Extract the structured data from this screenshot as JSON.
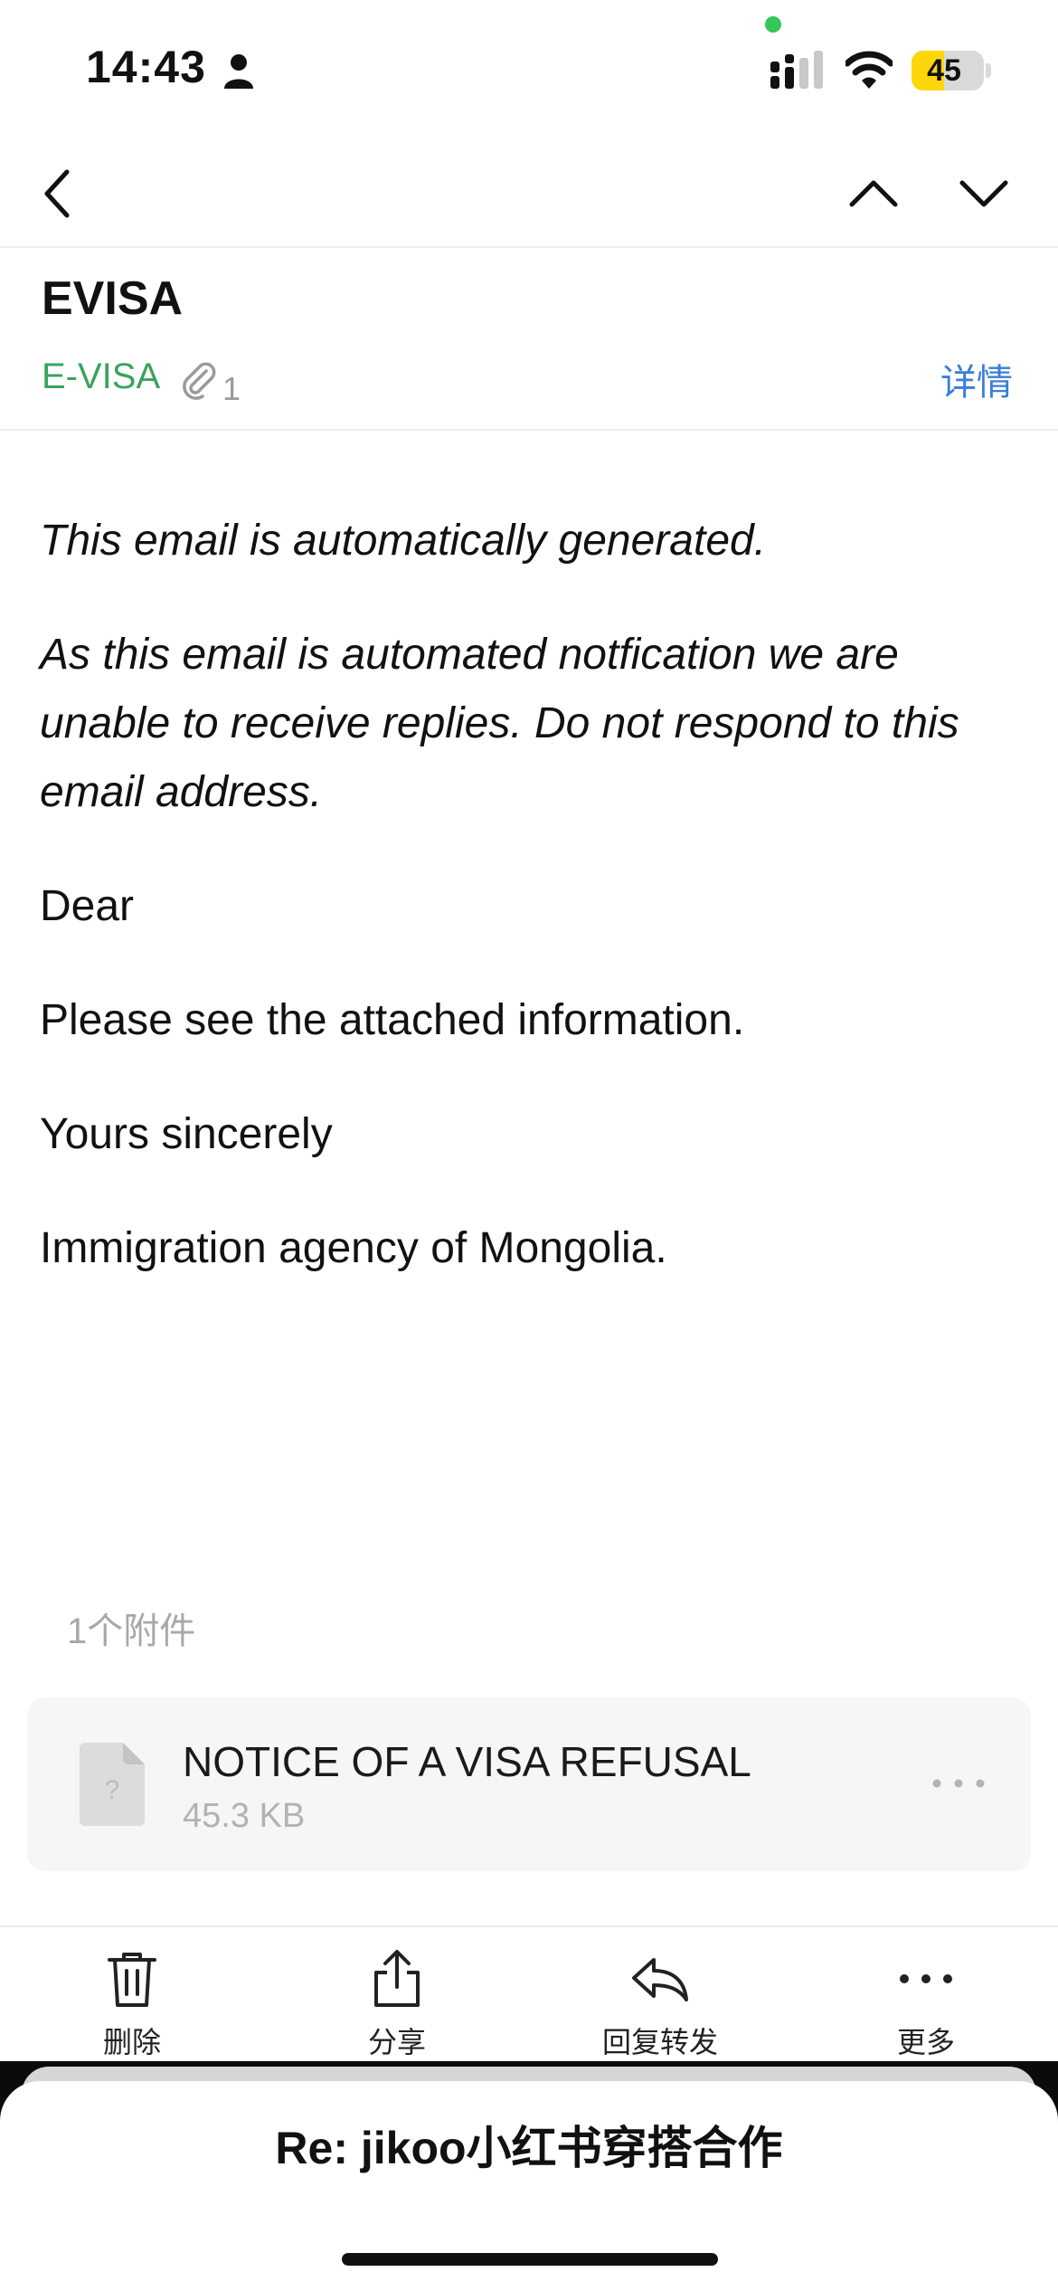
{
  "status_bar": {
    "time": "14:43",
    "battery_level": "45",
    "battery_fraction": 0.45,
    "icons": [
      "person-icon",
      "signal-icon",
      "wifi-icon",
      "battery-icon"
    ],
    "mic_indicator_color": "#34c759"
  },
  "nav": {
    "back_icon": "chevron-left-icon",
    "prev_icon": "chevron-up-icon",
    "next_icon": "chevron-down-icon"
  },
  "header": {
    "subject": "EVISA",
    "sender": "E-VISA",
    "attachment_count": "1",
    "details_label": "详情",
    "sender_color": "#3aa35c",
    "link_color": "#3a7ed6"
  },
  "body": {
    "paragraphs": [
      {
        "text": "This email is automatically generated.",
        "italic": true
      },
      {
        "text": "As this email is automated notfication we are unable to receive replies. Do not respond to this email address.",
        "italic": true
      },
      {
        "text": "Dear",
        "italic": false
      },
      {
        "text": "Please see the attached information.",
        "italic": false
      },
      {
        "text": "Yours sincerely",
        "italic": false
      },
      {
        "text": "Immigration agency of Mongolia.",
        "italic": false
      }
    ]
  },
  "attachments": {
    "heading": "1个附件",
    "items": [
      {
        "name": "NOTICE OF A VISA REFUSAL",
        "size": "45.3 KB",
        "icon": "unknown-file-icon"
      }
    ]
  },
  "toolbar": {
    "delete_label": "删除",
    "share_label": "分享",
    "reply_forward_label": "回复转发",
    "more_label": "更多"
  },
  "sheet": {
    "title": "Re: jikoo小红书穿搭合作"
  }
}
